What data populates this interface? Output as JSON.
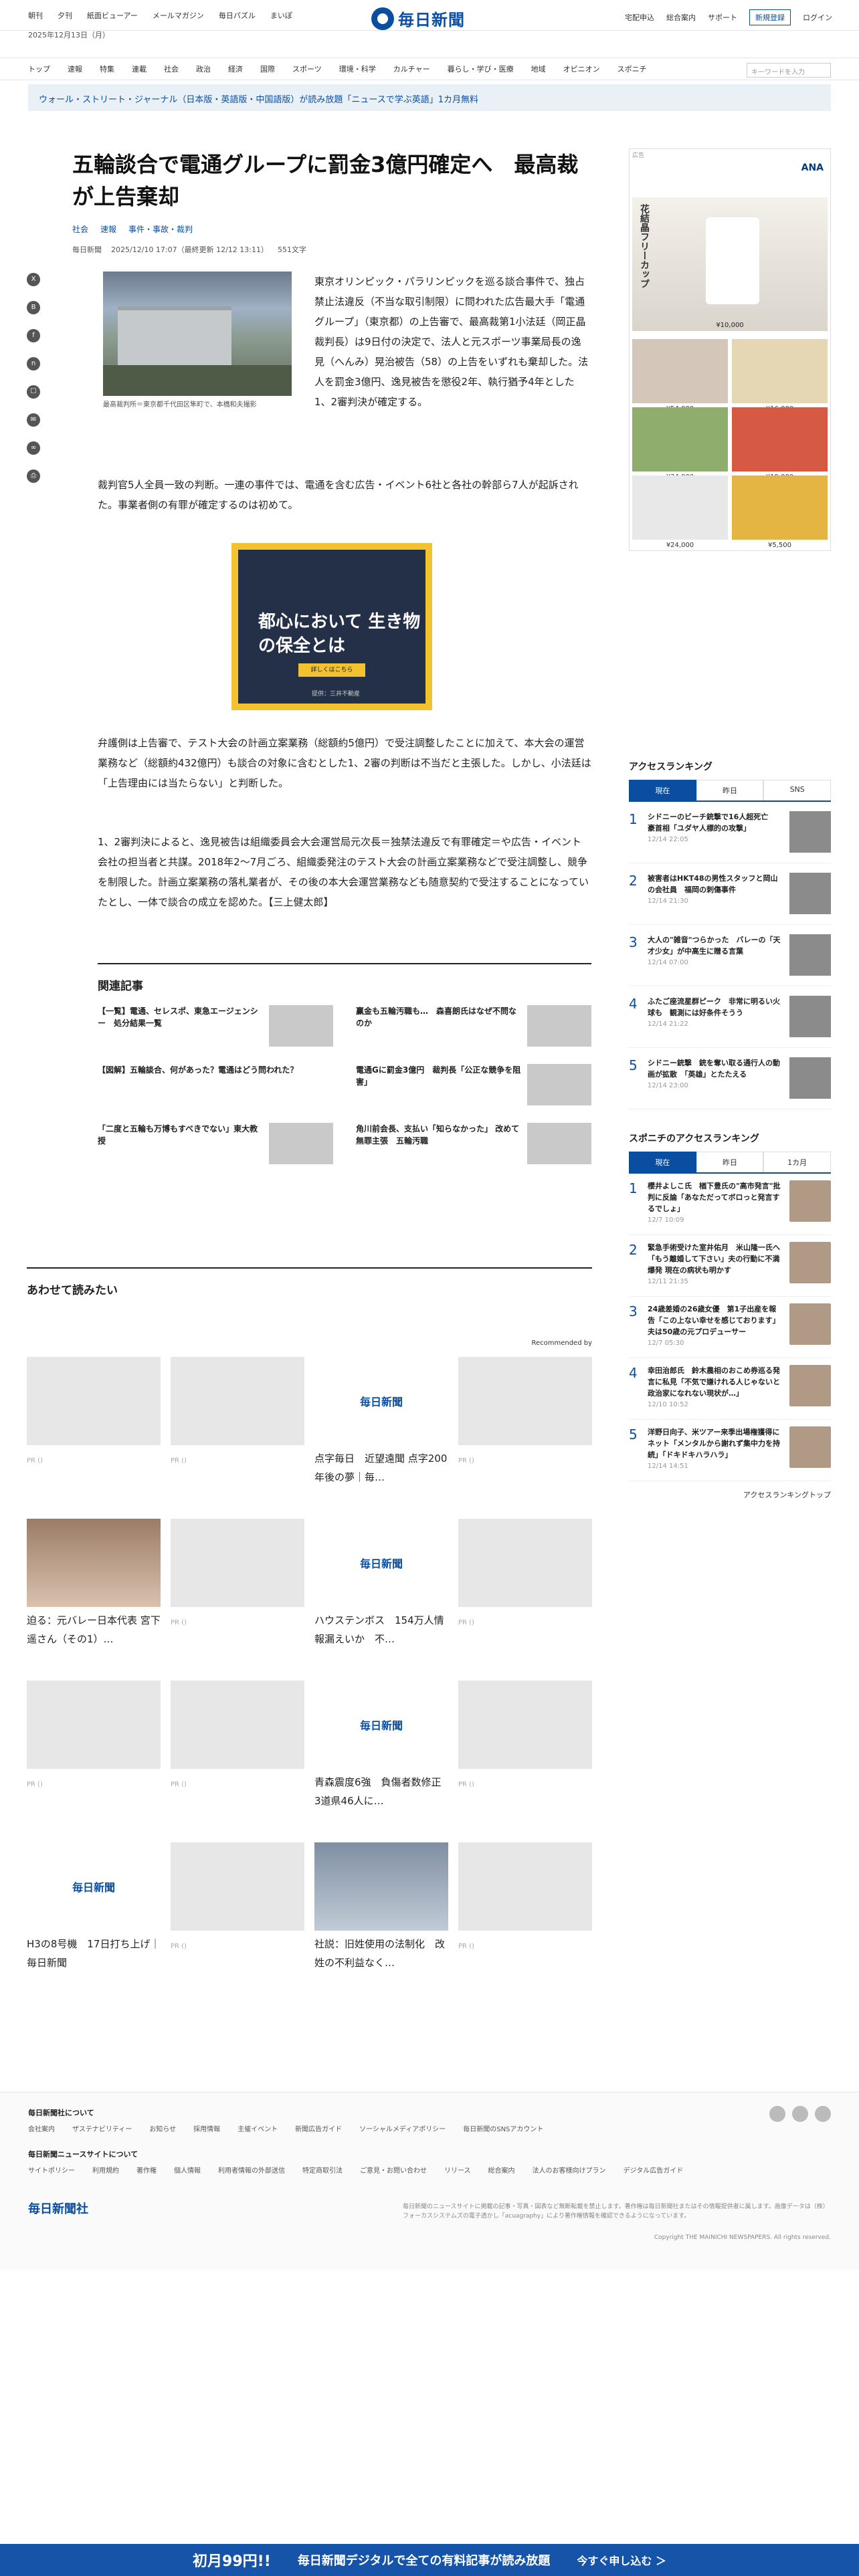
{
  "header": {
    "links": [
      "朝刊",
      "夕刊",
      "紙面ビューアー",
      "メールマガジン",
      "毎日パズル",
      "まいぽ"
    ],
    "date": "2025年12月13日（月）",
    "logo": "毎日新聞",
    "right_links": [
      "宅配申込",
      "総合案内",
      "サポート"
    ],
    "register": "新規登録",
    "login": "ログイン"
  },
  "nav": {
    "items": [
      "トップ",
      "速報",
      "特集",
      "連載",
      "社会",
      "政治",
      "経済",
      "国際",
      "スポーツ",
      "環境・科学",
      "カルチャー",
      "暮らし・学び・医療",
      "地域",
      "オピニオン",
      "スポニチ"
    ],
    "search_placeholder": "キーワードを入力"
  },
  "banner": "ウォール・ストリート・ジャーナル（日本版・英語版・中国語版）が読み放題「ニュースで学ぶ英語」1カ月無料",
  "article": {
    "title": "五輪談合で電通グループに罰金3億円確定へ　最高裁が上告棄却",
    "tags": [
      "社会",
      "速報",
      "事件・事故・裁判"
    ],
    "meta": [
      "毎日新聞",
      "2025/12/10 17:07（最終更新 12/12 13:11）",
      "551文字"
    ],
    "caption": "最高裁判所＝東京都千代田区隼町で、本橋和夫撮影",
    "p1": "東京オリンピック・パラリンピックを巡る談合事件で、独占禁止法違反（不当な取引制限）に問われた広告最大手「電通グループ」（東京都）の上告審で、最高裁第1小法廷（岡正晶裁判長）は9日付の決定で、法人と元スポーツ事業局長の逸見（へんみ）晃治被告（58）の上告をいずれも棄却した。法人を罰金3億円、逸見被告を懲役2年、執行猶予4年とした1、2審判決が確定する。",
    "p2": "裁判官5人全員一致の判断。一連の事件では、電通を含む広告・イベント6社と各社の幹部ら7人が起訴された。事業者側の有罪が確定するのは初めて。",
    "p3": "弁護側は上告審で、テスト大会の計画立案業務（総額約5億円）で受注調整したことに加えて、本大会の運営業務など（総額約432億円）も談合の対象に含むとした1、2審の判断は不当だと主張した。しかし、小法廷は「上告理由には当たらない」と判断した。",
    "p4": "1、2審判決によると、逸見被告は組織委員会大会運営局元次長＝独禁法違反で有罪確定＝や広告・イベント会社の担当者と共謀。2018年2～7月ごろ、組織委発注のテスト大会の計画立案業務などで受注調整し、競争を制限した。計画立案業務の落札業者が、その後の本大会運営業務なども随意契約で受注することになっていたとし、一体で談合の成立を認めた。【三上健太郎】"
  },
  "ad_mid": {
    "text": "都心において 生き物の保全とは",
    "button": "詳しくはこちら",
    "sponsor": "提供：三井不動産"
  },
  "related": {
    "heading": "関連記事",
    "items": [
      "【一覧】電通、セレスポ、東急エージェンシー　処分結果一覧",
      "赢金も五輪汚職も…　森喜朗氏はなぜ不問なのか",
      "【図解】五輪談合、何があった？電通はどう問われた？",
      "電通Gに罰金3億円　裁判長「公正な競争を阻害」",
      "「二度と五輪も万博もすべきでない」東大教授",
      "角川前会長、支払い「知らなかった」 改めて無罪主張　五輪汚職"
    ]
  },
  "reads": {
    "heading": "あわせて読みたい",
    "recommended": "Recommended by",
    "cards": [
      {
        "title": "",
        "pr": "PR ()"
      },
      {
        "title": "",
        "pr": "PR ()"
      },
      {
        "title": "点字毎日　近望遠聞 点字200年後の夢｜毎…",
        "pr": ""
      },
      {
        "title": "",
        "pr": "PR ()"
      },
      {
        "title": "迫る：元バレー日本代表 宮下遥さん（その1）…",
        "pr": ""
      },
      {
        "title": "",
        "pr": "PR ()"
      },
      {
        "title": "ハウステンボス　154万人情報漏えいか　不…",
        "pr": ""
      },
      {
        "title": "",
        "pr": "PR ()"
      },
      {
        "title": "",
        "pr": "PR ()"
      },
      {
        "title": "",
        "pr": "PR ()"
      },
      {
        "title": "青森震度6強　負傷者数修正　3道県46人に…",
        "pr": ""
      },
      {
        "title": "",
        "pr": "PR ()"
      },
      {
        "title": "H3の8号機　17日打ち上げ｜毎日新聞",
        "pr": ""
      },
      {
        "title": "",
        "pr": "PR ()"
      },
      {
        "title": "社説：旧姓使用の法制化　改姓の不利益なく…",
        "pr": ""
      },
      {
        "title": "",
        "pr": "PR ()"
      }
    ]
  },
  "sidebar_ad": {
    "label": "広告",
    "brand": "ANA",
    "hero": "花結晶フリーカップ",
    "prices": [
      "¥10,000",
      "¥54,000",
      "¥16,000",
      "¥34,000",
      "¥19,000",
      "¥24,000",
      "¥5,500"
    ]
  },
  "ranking": {
    "heading": "アクセスランキング",
    "tabs": [
      "現在",
      "昨日",
      "SNS"
    ],
    "items": [
      {
        "n": "1",
        "t": "シドニーのビーチ銃撃で16人超死亡　豪首相「ユダヤ人標的の攻撃」",
        "d": "12/14 22:05"
      },
      {
        "n": "2",
        "t": "被害者はHKT48の男性スタッフと岡山の会社員　福岡の刺傷事件",
        "d": "12/14 21:30"
      },
      {
        "n": "3",
        "t": "大人の\"雑音\"つらかった　バレーの「天才少女」が中高生に贈る言葉",
        "d": "12/14 07:00"
      },
      {
        "n": "4",
        "t": "ふたご座流星群ピーク　非常に明るい火球も　観測には好条件そうう",
        "d": "12/14 21:22"
      },
      {
        "n": "5",
        "t": "シドニー銃撃　銃を奪い取る通行人の動画が拡散　「英雄」とたたえる",
        "d": "12/14 23:00"
      }
    ]
  },
  "ranking2": {
    "heading": "スポニチのアクセスランキング",
    "tabs": [
      "現在",
      "昨日",
      "1カ月"
    ],
    "items": [
      {
        "n": "1",
        "t": "櫻井よしこ氏　楢下豊氏の\"高市発言\"批判に反論「あなただってボロっと発言するでしょ」",
        "d": "12/7 10:09"
      },
      {
        "n": "2",
        "t": "緊急手術受けた室井佑月　米山隆一氏へ「もう離婚して下さい」夫の行動に不満爆発 現在の病状も明かす",
        "d": "12/11 21:35"
      },
      {
        "n": "3",
        "t": "24歳差婚の26歳女優　第1子出産を報告「この上ない幸せを感じております」夫は50歳の元プロデューサー",
        "d": "12/7 05:30"
      },
      {
        "n": "4",
        "t": "幸田治郎氏　鈴木農相のおこめ券巡る発言に私見「不気で嫌けれる人じゃないと政治家になれない現状が…」",
        "d": "12/10 10:52"
      },
      {
        "n": "5",
        "t": "洋野日向子、米ツアー来季出場権獲得にネット「メンタルから謝れず集中力を持続」「ドキドキハラハラ」",
        "d": "12/14 14:51"
      }
    ],
    "more": "アクセスランキングトップ"
  },
  "footer": {
    "sec1": "毎日新聞社について",
    "links1": [
      "会社案内",
      "ザステナビリティー",
      "お知らせ",
      "採用情報",
      "主催イベント",
      "新聞広告ガイド",
      "ソーシャルメディアポリシー",
      "毎日新聞のSNSアカウント"
    ],
    "sec2": "毎日新聞ニュースサイトについて",
    "links2": [
      "サイトポリシー",
      "利用規約",
      "著作権",
      "個人情報",
      "利用者情報の外部送信",
      "特定商取引法",
      "ご意見・お問い合わせ",
      "リリース",
      "総合案内",
      "法人のお客様向けプラン",
      "デジタル広告ガイド"
    ],
    "logo": "毎日新聞社",
    "note": "毎日新聞のニュースサイトに掲載の記事・写真・図表など無断転載を禁止します。著作権は毎日新聞社またはその情報提供者に属します。画像データは（株）フォーカスシステムズの電子透かし「acuagraphy」により著作権情報を確認できるようになっています。",
    "copyright": "Copyright THE MAINICHI NEWSPAPERS. All rights reserved."
  },
  "bottom": {
    "price": "初月99円!!",
    "text": "毎日新聞デジタルで全ての有料記事が読み放題",
    "cta": "今すぐ申し込む ＞"
  }
}
